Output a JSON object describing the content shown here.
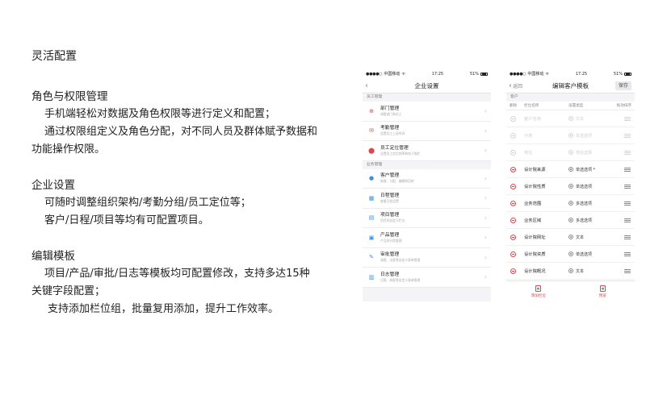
{
  "title": "灵活配置",
  "sections": [
    {
      "heading": "角色与权限管理",
      "lines": [
        "手机端轻松对数据及角色权限等进行定义和配置；",
        "通过权限组定义及角色分配，对不同人员及群体赋予数据和",
        "功能操作权限。"
      ]
    },
    {
      "heading": "企业设置",
      "lines": [
        "可随时调整组织架构/考勤分组/员工定位等；",
        "客户/日程/项目等均有可配置项目。"
      ]
    },
    {
      "heading": "编辑模板",
      "lines": [
        "项目/产品/审批/日志等模板均可配置修改，支持多达15种",
        "关键字段配置；",
        "支持添加栏位组，批量复用添加，提升工作效率。"
      ]
    }
  ],
  "phone1": {
    "status": {
      "carrier": "中国移动",
      "time": "17:25",
      "battery": "51%"
    },
    "nav_title": "企业设置",
    "groups": [
      {
        "label": "员工管理",
        "items": [
          {
            "title": "部门管理",
            "sub": "调整部门和员工",
            "icon": "org-icon",
            "color": "#e0454a"
          },
          {
            "title": "考勤管理",
            "sub": "设置员工上班时间",
            "icon": "mail-icon",
            "color": "#e0454a"
          },
          {
            "title": "员工定位管理",
            "sub": "设置员工定位频率和电子围栏",
            "icon": "location-pin-icon",
            "color": "#e0454a"
          }
        ]
      },
      {
        "label": "业务管理",
        "items": [
          {
            "title": "客户管理",
            "sub": "新建、分配、编辑和回款",
            "icon": "person-icon",
            "color": "#3c8ee6"
          },
          {
            "title": "日程管理",
            "sub": "查看日程设置",
            "icon": "calendar-icon",
            "color": "#3c8ee6"
          },
          {
            "title": "项目管理",
            "sub": "项目的自定义栏位",
            "icon": "document-icon",
            "color": "#3c8ee6"
          },
          {
            "title": "产品管理",
            "sub": "产品的分类管理",
            "icon": "box-icon",
            "color": "#3c8ee6"
          },
          {
            "title": "审批管理",
            "sub": "请假、出差等自定义表单管理",
            "icon": "approval-icon",
            "color": "#3c8ee6"
          },
          {
            "title": "日志管理",
            "sub": "日报、周报等自定义表单管理",
            "icon": "log-icon",
            "color": "#3c8ee6"
          }
        ]
      }
    ]
  },
  "phone2": {
    "status": {
      "carrier": "中国移动",
      "time": "17:25",
      "battery": "51%"
    },
    "back_label": "返回",
    "nav_title": "编辑客户模板",
    "save_label": "保存",
    "group_label": "客户",
    "columns": {
      "del": "删除",
      "name": "栏位名称",
      "type": "设置类型",
      "sort": "拖动排序"
    },
    "fields": [
      {
        "name": "客户名称",
        "type": "文本",
        "disabled": true
      },
      {
        "name": "分类",
        "type": "单选选项",
        "disabled": true
      },
      {
        "name": "地址",
        "type": "地址选择",
        "disabled": true
      },
      {
        "name": "设计院来源",
        "type": "单选选项 *",
        "disabled": false
      },
      {
        "name": "设计院性质",
        "type": "单选选项",
        "disabled": false
      },
      {
        "name": "业务范围",
        "type": "多选选项",
        "disabled": false
      },
      {
        "name": "业务区域",
        "type": "多选选项",
        "disabled": false
      },
      {
        "name": "设计院网址",
        "type": "文本",
        "disabled": false
      },
      {
        "name": "设计院资质",
        "type": "单选选项",
        "disabled": false
      },
      {
        "name": "设计院概况",
        "type": "文本",
        "disabled": false
      }
    ],
    "tabs": [
      {
        "label": "添加栏位",
        "icon": "add-field-icon"
      },
      {
        "label": "预览",
        "icon": "preview-icon"
      }
    ]
  }
}
